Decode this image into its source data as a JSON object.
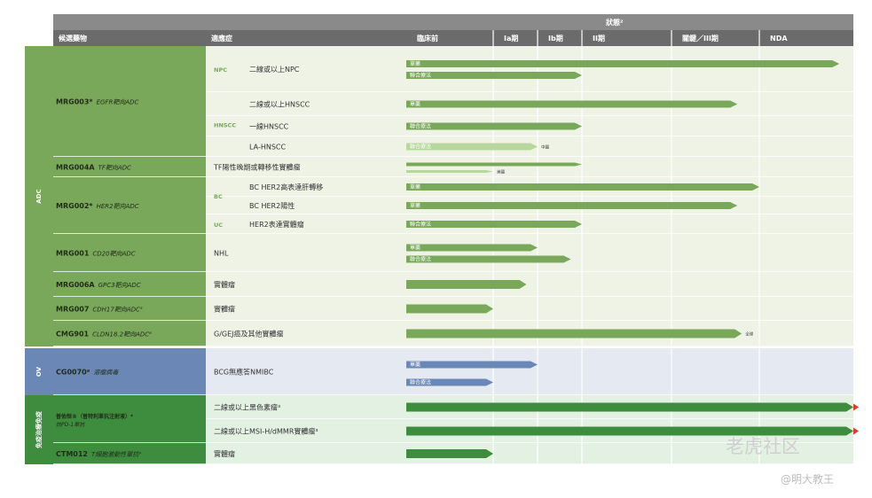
{
  "header": {
    "status_title": "狀態²",
    "col_candidate": "候選藥物",
    "col_indication": "適應症",
    "phases": [
      "臨床前",
      "Ia期",
      "Ib期",
      "II期",
      "關鍵／III期",
      "NDA"
    ]
  },
  "modalities": [
    {
      "label": "ADC",
      "color": "#79a85a"
    },
    {
      "label": "OV",
      "color": "#6a87b5"
    },
    {
      "label": "免疫\n治療\n免疫",
      "color": "#3e8c3e"
    }
  ],
  "candidates": [
    {
      "name": "MRG003*",
      "target": "EGFR靶向ADC"
    },
    {
      "name": "MRG004A",
      "target": "TF靶向ADC"
    },
    {
      "name": "MRG002*",
      "target": "HER2靶向ADC"
    },
    {
      "name": "MRG001",
      "target": "CD20靶向ADC"
    },
    {
      "name": "MRG006A",
      "target": "GPC3靶向ADC"
    },
    {
      "name": "MRG007",
      "target": "CDH17靶向ADC⁵"
    },
    {
      "name": "CMG901",
      "target": "CLDN18.2靶向ADC⁶"
    },
    {
      "name": "CG0070⁸",
      "target": "溶瘤病毒"
    },
    {
      "name": "普佑恒®（普特利單抗注射液）*",
      "target": "抗PD-1單抗"
    },
    {
      "name": "CTM012",
      "target": "T細胞激動性單抗⁹"
    }
  ],
  "indications": [
    {
      "code": "NPC",
      "text": "二線或以上NPC"
    },
    {
      "code": "HNSCC",
      "text": "二線或以上HNSCC"
    },
    {
      "code": "",
      "text": "一線HNSCC"
    },
    {
      "code": "",
      "text": "LA-HNSCC"
    },
    {
      "code": "",
      "text": "TF陽性晚期或轉移性實體瘤"
    },
    {
      "code": "BC",
      "text": "BC HER2高表達肝轉移"
    },
    {
      "code": "",
      "text": "BC HER2陽性"
    },
    {
      "code": "UC",
      "text": "HER2表達實體瘤"
    },
    {
      "code": "",
      "text": "NHL"
    },
    {
      "code": "",
      "text": "實體瘤"
    },
    {
      "code": "",
      "text": "實體瘤"
    },
    {
      "code": "",
      "text": "G/GEJ癌及其他實體瘤"
    },
    {
      "code": "",
      "text": "BCG無應答NMIBC"
    },
    {
      "code": "",
      "text": "二線或以上黑色素瘤³"
    },
    {
      "code": "",
      "text": "二線或以上MSI-H/dMMR實體瘤³"
    },
    {
      "code": "",
      "text": "實體瘤"
    }
  ],
  "bar_labels": {
    "mono": "單藥",
    "combo": "聯合療法"
  },
  "notes": {
    "china": "中國",
    "us": "美國",
    "global": "全球"
  },
  "chart_data": {
    "type": "table",
    "title": "",
    "phases": [
      "臨床前",
      "Ia期",
      "Ib期",
      "II期",
      "關鍵／III期",
      "NDA"
    ],
    "bars": [
      {
        "candidate": "MRG003*",
        "indication": "二線或以上NPC",
        "label": "單藥",
        "stage": 5.85
      },
      {
        "candidate": "MRG003*",
        "indication": "二線或以上NPC",
        "label": "聯合療法",
        "stage": 3.0
      },
      {
        "candidate": "MRG003*",
        "indication": "二線或以上HNSCC",
        "label": "單藥",
        "stage": 4.75
      },
      {
        "candidate": "MRG003*",
        "indication": "一線HNSCC",
        "label": "聯合療法",
        "stage": 3.0
      },
      {
        "candidate": "MRG003*",
        "indication": "LA-HNSCC",
        "label": "聯合療法",
        "stage": 2.0,
        "note": "中國"
      },
      {
        "candidate": "MRG004A",
        "indication": "TF陽性晚期或轉移性實體瘤",
        "label": "",
        "stage": 3.0
      },
      {
        "candidate": "MRG004A",
        "indication": "TF陽性晚期或轉移性實體瘤",
        "label": "",
        "stage": 1.0,
        "note": "美國"
      },
      {
        "candidate": "MRG002*",
        "indication": "BC HER2高表達肝轉移",
        "label": "單藥",
        "stage": 5.0
      },
      {
        "candidate": "MRG002*",
        "indication": "BC HER2陽性",
        "label": "單藥",
        "stage": 4.75
      },
      {
        "candidate": "MRG002*",
        "indication": "HER2表達實體瘤",
        "label": "聯合療法",
        "stage": 3.0
      },
      {
        "candidate": "MRG001",
        "indication": "NHL",
        "label": "單藥",
        "stage": 2.0
      },
      {
        "candidate": "MRG001",
        "indication": "NHL",
        "label": "聯合療法",
        "stage": 2.75
      },
      {
        "candidate": "MRG006A",
        "indication": "實體瘤",
        "label": "",
        "stage": 1.75
      },
      {
        "candidate": "MRG007",
        "indication": "實體瘤",
        "label": "",
        "stage": 1.0
      },
      {
        "candidate": "CMG901",
        "indication": "G/GEJ癌及其他實體瘤",
        "label": "",
        "stage": 4.8,
        "note": "全球"
      },
      {
        "candidate": "CG0070⁸",
        "indication": "BCG無應答NMIBC",
        "label": "單藥",
        "stage": 2.0
      },
      {
        "candidate": "CG0070⁸",
        "indication": "BCG無應答NMIBC",
        "label": "聯合療法",
        "stage": 1.0
      },
      {
        "candidate": "普佑恒®（普特利單抗注射液）*",
        "indication": "二線或以上黑色素瘤³",
        "label": "",
        "stage": 6.0
      },
      {
        "candidate": "普佑恒®（普特利單抗注射液）*",
        "indication": "二線或以上MSI-H/dMMR實體瘤³",
        "label": "",
        "stage": 6.0
      },
      {
        "candidate": "CTM012",
        "indication": "實體瘤",
        "label": "",
        "stage": 1.0
      }
    ]
  },
  "watermark": {
    "main": "老虎社区",
    "sub": "@明大教王"
  },
  "colors": {
    "adc_bg": "#eef3e6",
    "ov_bg": "#e4e9f2",
    "io_bg": "#e2f1e2",
    "adc_bar": "#79a85a",
    "ov_bar": "#6a87b5",
    "io_bar": "#3e8c3e",
    "light_bar": "#b9d79c"
  }
}
